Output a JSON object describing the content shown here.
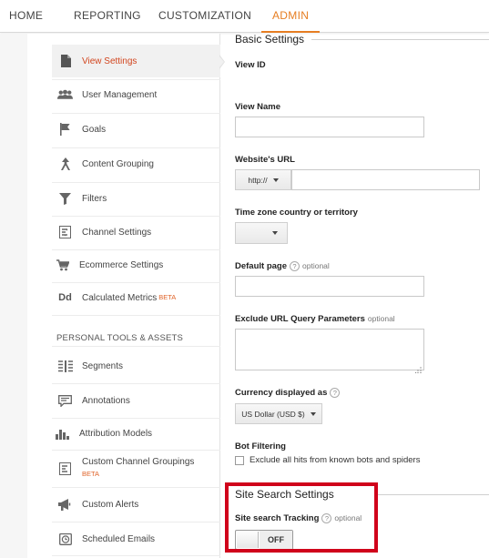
{
  "nav": {
    "tabs": [
      {
        "label": "HOME"
      },
      {
        "label": "REPORTING"
      },
      {
        "label": "CUSTOMIZATION"
      },
      {
        "label": "ADMIN",
        "active": true
      }
    ]
  },
  "sidebar": {
    "items": [
      {
        "label": "View Settings",
        "icon": "document-icon",
        "active": true
      },
      {
        "label": "User Management",
        "icon": "users-icon"
      },
      {
        "label": "Goals",
        "icon": "flag-icon"
      },
      {
        "label": "Content Grouping",
        "icon": "grouping-icon"
      },
      {
        "label": "Filters",
        "icon": "filter-icon"
      },
      {
        "label": "Channel Settings",
        "icon": "channel-icon"
      },
      {
        "label": "Ecommerce Settings",
        "icon": "cart-icon"
      },
      {
        "label": "Calculated Metrics",
        "badge": "BETA",
        "icon": "dd-icon"
      }
    ],
    "section_heading": "PERSONAL TOOLS & ASSETS",
    "personal_items": [
      {
        "label": "Segments",
        "icon": "segments-icon"
      },
      {
        "label": "Annotations",
        "icon": "annotation-icon"
      },
      {
        "label": "Attribution Models",
        "icon": "bar-chart-icon"
      },
      {
        "label": "Custom Channel Groupings",
        "badge": "BETA",
        "icon": "channel-icon"
      },
      {
        "label": "Custom Alerts",
        "icon": "megaphone-icon"
      },
      {
        "label": "Scheduled Emails",
        "icon": "clock-icon"
      }
    ]
  },
  "main": {
    "basic_settings_title": "Basic Settings",
    "view_id_label": "View ID",
    "view_name_label": "View Name",
    "view_name_value": "",
    "website_url_label": "Website's URL",
    "protocol_value": "http://",
    "website_url_value": "",
    "timezone_label": "Time zone country or territory",
    "timezone_value": "",
    "default_page_label": "Default page",
    "default_page_optional": "optional",
    "default_page_value": "",
    "exclude_params_label": "Exclude URL Query Parameters",
    "exclude_params_optional": "optional",
    "currency_label": "Currency displayed as",
    "currency_value": "US Dollar (USD $)",
    "bot_filtering_label": "Bot Filtering",
    "bot_filtering_checkbox_label": "Exclude all hits from known bots and spiders",
    "bot_filtering_checked": false,
    "site_search_title": "Site Search Settings",
    "site_search_tracking_label": "Site search Tracking",
    "site_search_optional": "optional",
    "site_search_state": "OFF",
    "help_glyph": "?"
  },
  "colors": {
    "accent": "#e67e22",
    "active_item_text": "#d2461f",
    "highlight_box": "#d0021b",
    "beta": "#e0642a"
  }
}
